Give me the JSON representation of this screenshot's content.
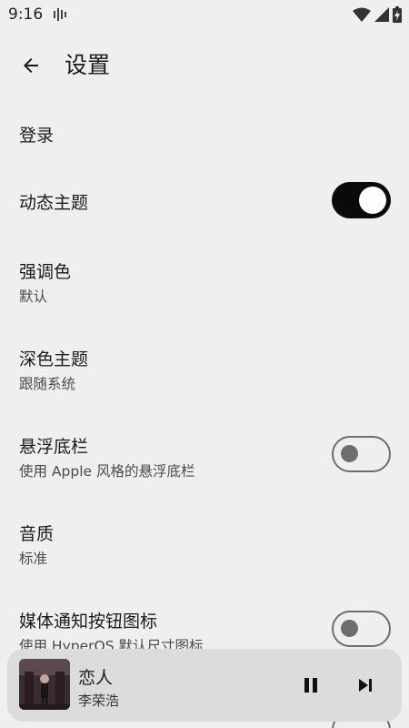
{
  "status_bar": {
    "time": "9:16",
    "icons": [
      "notification-icon",
      "wifi-icon",
      "cell-signal-icon",
      "battery-charging-icon"
    ]
  },
  "app_bar": {
    "back_icon": "arrow-back-icon",
    "title": "设置"
  },
  "settings": {
    "login": {
      "title": "登录"
    },
    "dynamic_theme": {
      "title": "动态主题",
      "enabled": true
    },
    "accent_color": {
      "title": "强调色",
      "subtitle": "默认"
    },
    "dark_theme": {
      "title": "深色主题",
      "subtitle": "跟随系统"
    },
    "floating_bar": {
      "title": "悬浮底栏",
      "subtitle": "使用 Apple 风格的悬浮底栏",
      "enabled": false
    },
    "audio_quality": {
      "title": "音质",
      "subtitle": "标准"
    },
    "media_notification_icon": {
      "title": "媒体通知按钮图标",
      "subtitle": "使用 HyperOS 默认尺寸图标",
      "enabled": false
    }
  },
  "mini_player": {
    "song_title": "恋人",
    "artist": "李荣浩",
    "play_state": "playing",
    "controls": [
      "pause-icon",
      "skip-next-icon"
    ]
  },
  "colors": {
    "background": "#efefef",
    "toggle_on": "#0a0a0a",
    "toggle_off_outline": "#6e6e6e",
    "mini_player_bg": "#dcdcdc"
  }
}
